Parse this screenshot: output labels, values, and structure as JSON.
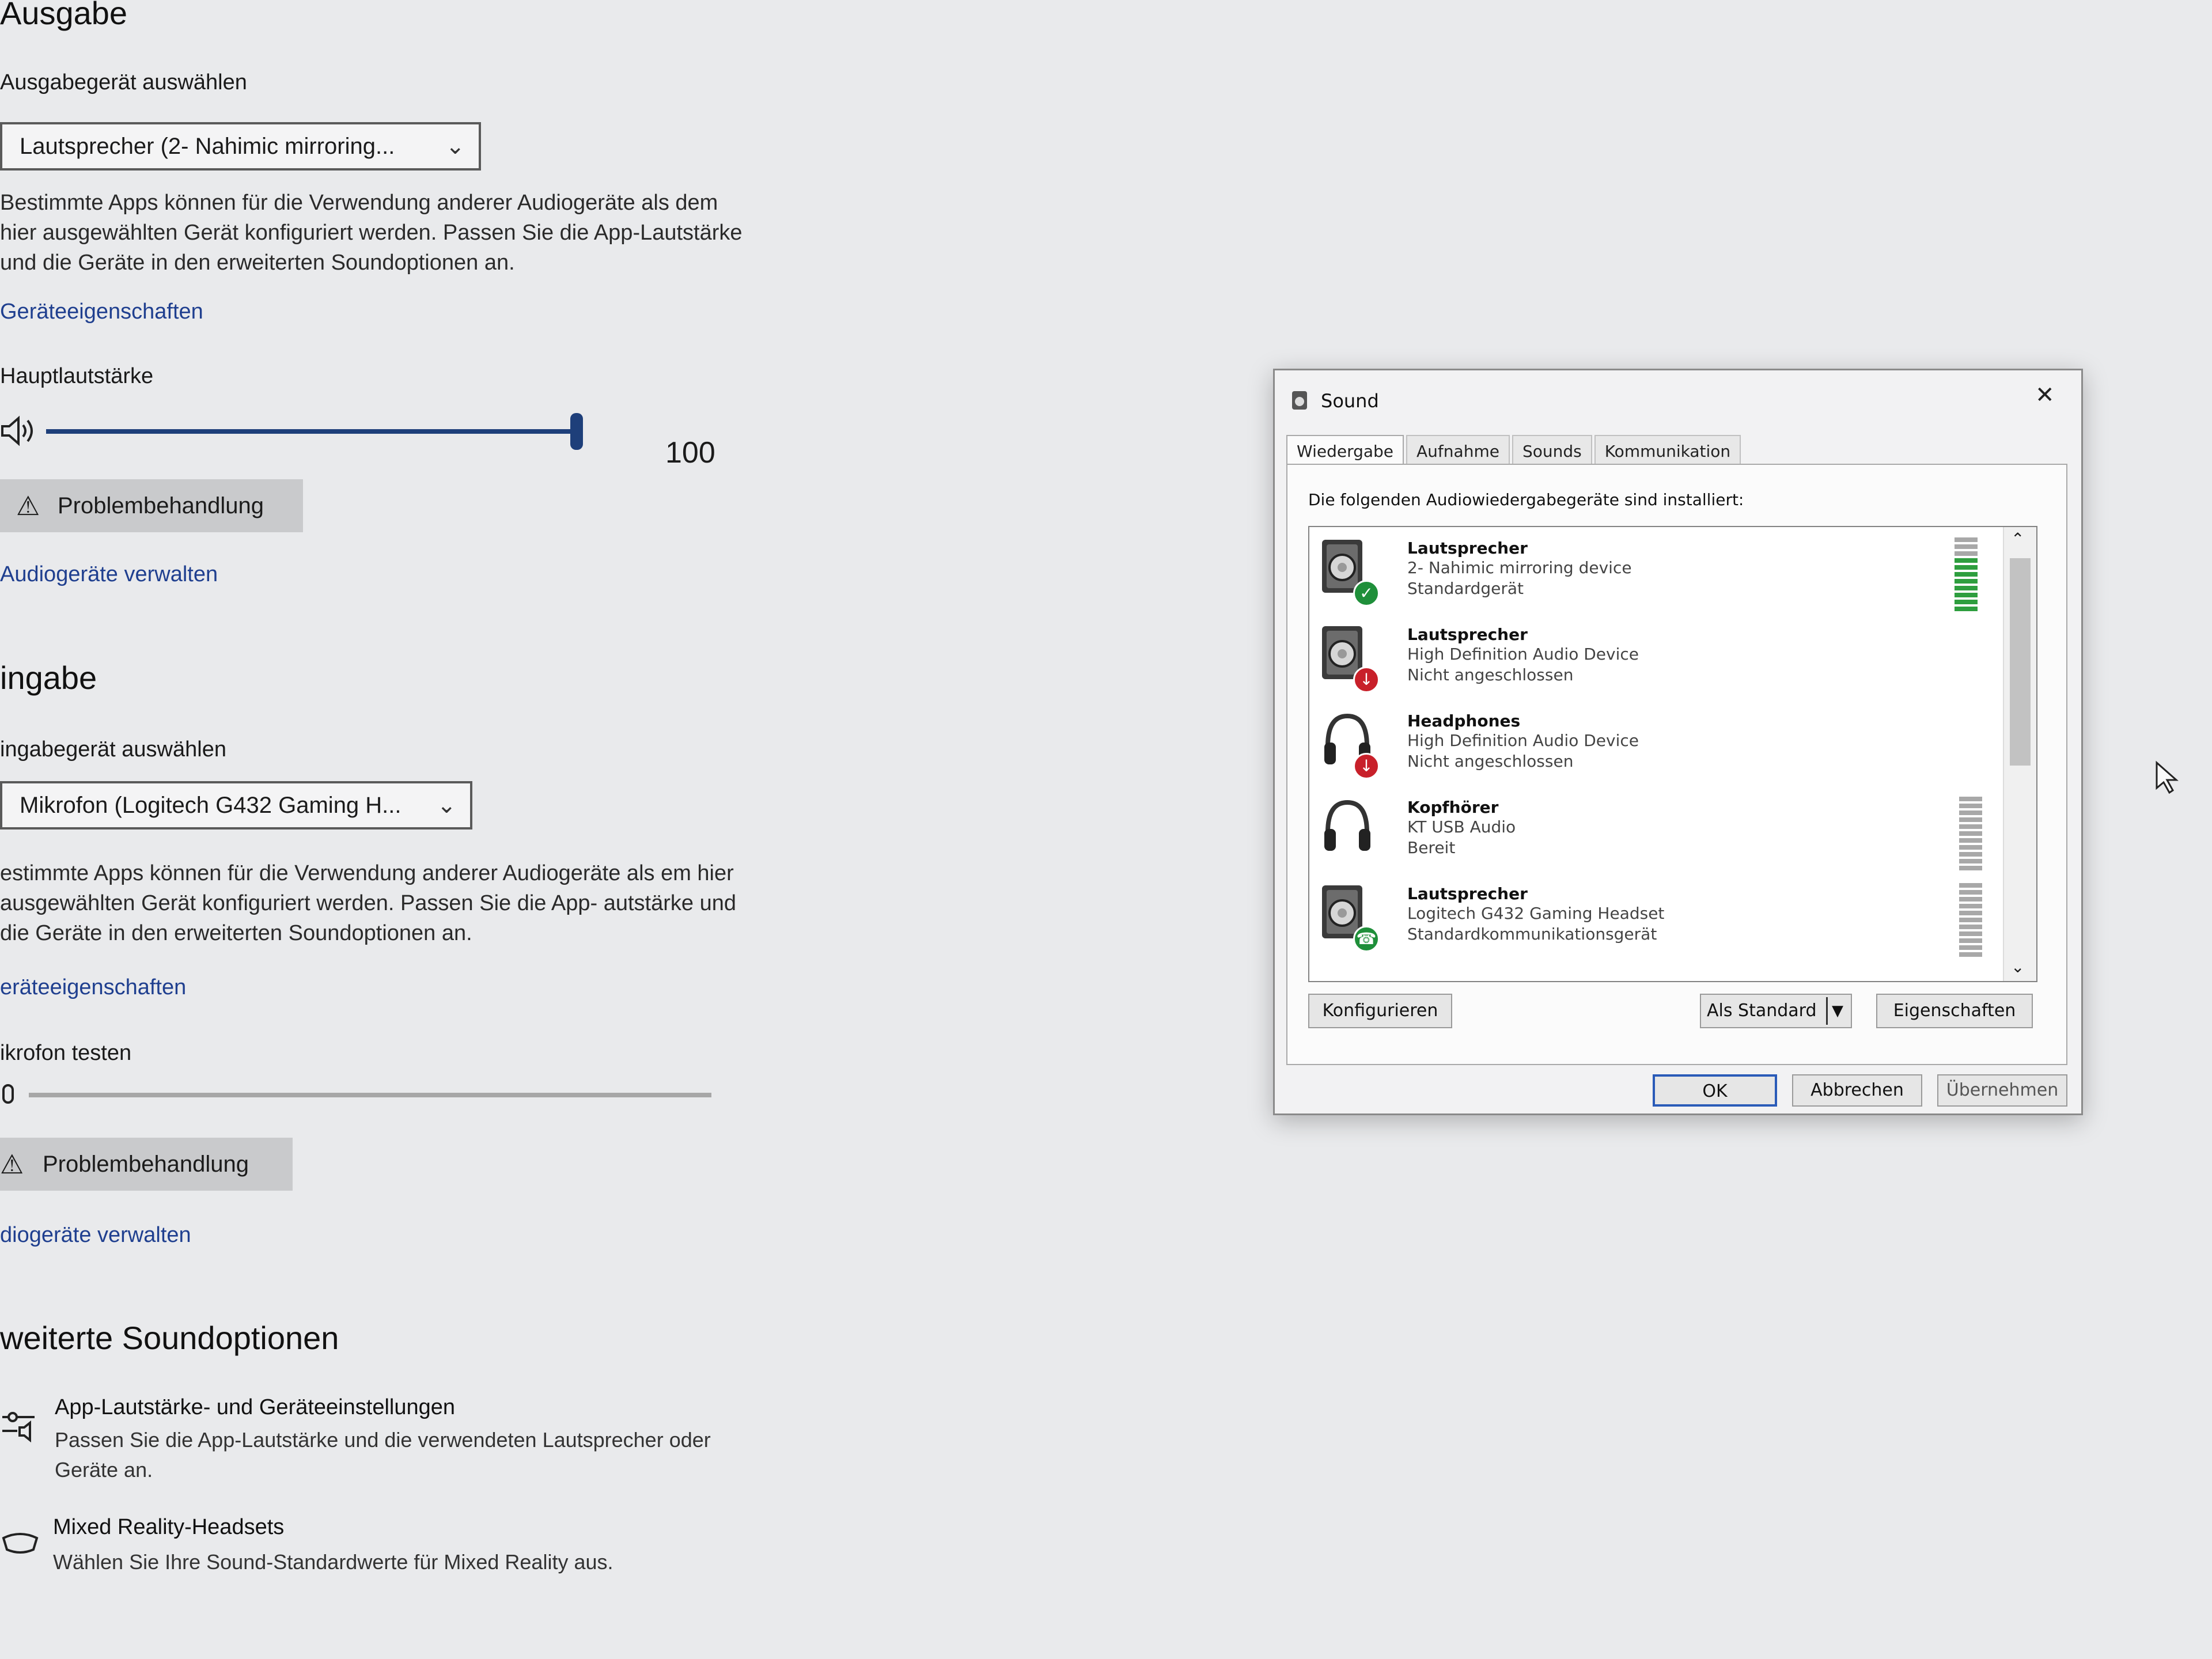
{
  "settings": {
    "output": {
      "heading": "Ausgabe",
      "device_label": "Ausgabegerät auswählen",
      "device_selected": "Lautsprecher (2- Nahimic mirroring...",
      "description": "Bestimmte Apps können für die Verwendung anderer Audiogeräte als dem hier ausgewählten Gerät konfiguriert werden. Passen Sie die App-Lautstärke und die Geräte in den erweiterten Soundoptionen an.",
      "properties_link": "Geräteeigenschaften",
      "volume_label": "Hauptlautstärke",
      "volume_value": "100",
      "volume_level": 1.0,
      "troubleshoot_button": "Problembehandlung",
      "manage_link": "Audiogeräte verwalten"
    },
    "input": {
      "heading": "ingabe",
      "device_label": "ingabegerät auswählen",
      "device_selected": "Mikrofon (Logitech G432 Gaming H...",
      "description": "estimmte Apps können für die Verwendung anderer Audiogeräte als em hier ausgewählten Gerät konfiguriert werden. Passen Sie die App- autstärke und die Geräte in den erweiterten Soundoptionen an.",
      "properties_link": "eräteeigenschaften",
      "test_label": "ikrofon testen",
      "troubleshoot_button": "Problembehandlung",
      "manage_link": "diogeräte verwalten"
    },
    "advanced": {
      "heading": "weiterte Soundoptionen",
      "items": [
        {
          "title": "App-Lautstärke- und Geräteeinstellungen",
          "description": "Passen Sie die App-Lautstärke und die verwendeten Lautsprecher oder Geräte an.",
          "icon": "mixer-icon"
        },
        {
          "title": "Mixed Reality-Headsets",
          "description": "Wählen Sie Ihre Sound-Standardwerte für Mixed Reality aus.",
          "icon": "vr-headset-icon"
        }
      ]
    }
  },
  "dialog": {
    "title": "Sound",
    "close_glyph": "✕",
    "tabs": [
      {
        "label": "Wiedergabe",
        "active": true
      },
      {
        "label": "Aufnahme",
        "active": false
      },
      {
        "label": "Sounds",
        "active": false
      },
      {
        "label": "Kommunikation",
        "active": false
      }
    ],
    "intro": "Die folgenden Audiowiedergabegeräte sind installiert:",
    "devices": [
      {
        "name": "Lautsprecher",
        "line2": "2- Nahimic mirroring device",
        "line3": "Standardgerät",
        "icon": "speaker-icon",
        "badge": "default-check-badge"
      },
      {
        "name": "Lautsprecher",
        "line2": "High Definition Audio Device",
        "line3": "Nicht angeschlossen",
        "icon": "speaker-icon",
        "badge": "disconnected-badge"
      },
      {
        "name": "Headphones",
        "line2": "High Definition Audio Device",
        "line3": "Nicht angeschlossen",
        "icon": "headphones-icon",
        "badge": "disconnected-badge"
      },
      {
        "name": "Kopfhörer",
        "line2": "KT USB Audio",
        "line3": "Bereit",
        "icon": "headphones-icon",
        "badge": ""
      },
      {
        "name": "Lautsprecher",
        "line2": "Logitech G432 Gaming Headset",
        "line3": "Standardkommunikationsgerät",
        "icon": "speaker-icon",
        "badge": "communication-phone-badge"
      }
    ],
    "buttons": {
      "configure": "Konfigurieren",
      "set_default": "Als Standard",
      "properties": "Eigenschaften",
      "ok": "OK",
      "cancel": "Abbrechen",
      "apply": "Übernehmen"
    }
  },
  "colors": {
    "link": "#1f3f8f",
    "accent": "#1e3f7a",
    "meter_active": "#2e9e3e",
    "badge_check": "#1f8f3a",
    "badge_disconnected": "#c8202a"
  }
}
